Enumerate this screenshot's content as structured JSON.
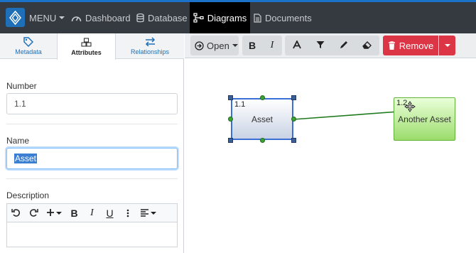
{
  "nav": {
    "menu_label": "MENU",
    "items": [
      {
        "label": "Dashboard",
        "icon": "dashboard-icon"
      },
      {
        "label": "Database",
        "icon": "database-icon"
      },
      {
        "label": "Diagrams",
        "icon": "diagram-icon",
        "active": true
      },
      {
        "label": "Documents",
        "icon": "document-icon"
      }
    ]
  },
  "tabs": [
    {
      "label": "Metadata",
      "icon": "tag-icon"
    },
    {
      "label": "Attributes",
      "icon": "cubes-icon",
      "active": true
    },
    {
      "label": "Relationships",
      "icon": "arrows-icon"
    }
  ],
  "form": {
    "number_label": "Number",
    "number_value": "1.1",
    "name_label": "Name",
    "name_value": "Asset",
    "description_label": "Description"
  },
  "toolbar": {
    "open_label": "Open",
    "bold_label": "B",
    "italic_label": "I",
    "remove_label": "Remove"
  },
  "editor_toolbar": {
    "bold": "B",
    "italic": "I",
    "underline": "U"
  },
  "diagram": {
    "nodes": [
      {
        "number": "1.1",
        "label": "Asset",
        "selected": true
      },
      {
        "number": "1.2",
        "label": "Another Asset",
        "selected": false
      }
    ]
  },
  "colors": {
    "nav_bg": "#343a40",
    "accent": "#1e6fb8",
    "remove": "#dc3545",
    "edge": "#1e7a1e"
  }
}
